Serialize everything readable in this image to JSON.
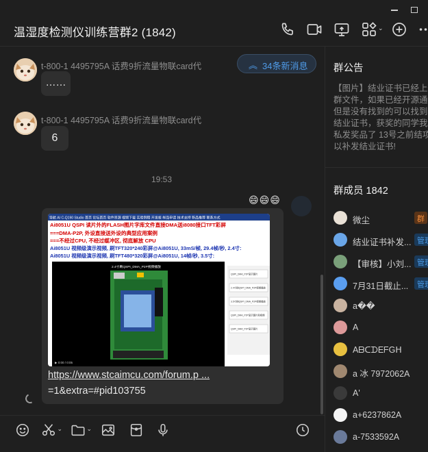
{
  "window": {
    "title": "温湿度检测仪训练营群2 (1842)"
  },
  "messages": [
    {
      "sender": "t-800-1 4495795A 话费9折流量物联card代",
      "text": "……"
    },
    {
      "sender": "t-800-1 4495795A 话费9折流量物联card代",
      "text": "6"
    }
  ],
  "new_messages_label": "34条新消息",
  "timestamp": "19:53",
  "emojis": "😄😄😄",
  "image_post": {
    "nav_items": [
      "导航 AI C-Q190 Studio",
      "首页",
      "论坛首页",
      "软件资源",
      "视频下载",
      "实验例程",
      "开发板",
      "样品申请",
      "技术支持",
      "新品推荐",
      "联系方式"
    ],
    "lines": [
      "Ai8051U QSPI 读片外的FLASH图片字库文件直接DMA送i8080接口TFT彩屏",
      "===DMA-P2P, 外设直接送外设的典型应用案例",
      "===不经过CPU, 不经过缓冲区, 彻底解放 CPU",
      "Ai8051U 视频级演示视频, 刷TFT320*240彩屏@Ai8051U, 33mS/帧, 29.4帧/秒, 2.4寸:",
      "Ai8051U 视频级演示视频, 刷TFT480*320彩屏@Ai8051U, 14帧/秒, 3.5寸:"
    ],
    "video_title": "2.4寸刷QSPI_DMA_P2P视频播放",
    "video_time": "0:00 / 0:05",
    "playlist": [
      "QSPI_DMA_P2P显示图片",
      "2.4寸刷QSPI_DMA_P2P视频播放",
      "3.5寸刷QSPI_DMA_P2P视频播放",
      "QSPI_DMA_P2P显示图片和视频",
      "QSPI_DMA_P2P显示图片"
    ]
  },
  "link": {
    "line1": "https://www.stcaimcu.com/forum.p ...",
    "line2": "=1&extra=#pid103755"
  },
  "toolbar": {
    "icons": [
      "smile-icon",
      "scissors-icon",
      "folder-icon",
      "image-icon",
      "red-packet-icon",
      "microphone-icon",
      "history-icon"
    ]
  },
  "sidebar": {
    "notice_title": "群公告",
    "notice_lines": [
      "【图片】结业证书已经上传",
      "群文件，如果已经开源通过",
      "但是没有找到的可以找到补",
      "结业证书，获奖的同学我已",
      "私发奖品了 13号之前结项",
      "以补发结业证书!"
    ],
    "members_title": "群成员 1842",
    "members": [
      {
        "name": "微尘",
        "badge": "群",
        "badge_type": "owner",
        "avatar_color": "#e9e1d6"
      },
      {
        "name": "结业证书补发...",
        "badge": "管理",
        "badge_type": "admin",
        "avatar_color": "#6aa6e8"
      },
      {
        "name": "【审核】小刘...",
        "badge": "管理",
        "badge_type": "admin",
        "avatar_color": "#7aa07a"
      },
      {
        "name": "7月31日截止...",
        "badge": "管理",
        "badge_type": "admin",
        "avatar_color": "#5a9ef0"
      },
      {
        "name": "a��",
        "badge": "",
        "badge_type": "",
        "avatar_color": "#c9b3a0"
      },
      {
        "name": "A",
        "badge": "",
        "badge_type": "",
        "avatar_color": "#d99"
      },
      {
        "name": "AᗷᑕᗪEᖴGᕼ",
        "badge": "",
        "badge_type": "",
        "avatar_color": "#e8c040"
      },
      {
        "name": "a 冰 7972062A",
        "badge": "",
        "badge_type": "",
        "avatar_color": "#a08870"
      },
      {
        "name": "A'",
        "badge": "",
        "badge_type": "",
        "avatar_color": "#3a3a3a"
      },
      {
        "name": "a+6237862A",
        "badge": "",
        "badge_type": "",
        "avatar_color": "#f4f4f4"
      },
      {
        "name": "a-7533592A",
        "badge": "",
        "badge_type": "",
        "avatar_color": "#6a7a9a"
      },
      {
        "name": "",
        "badge": "",
        "badge_type": "",
        "avatar_color": "#b0a090"
      }
    ]
  }
}
